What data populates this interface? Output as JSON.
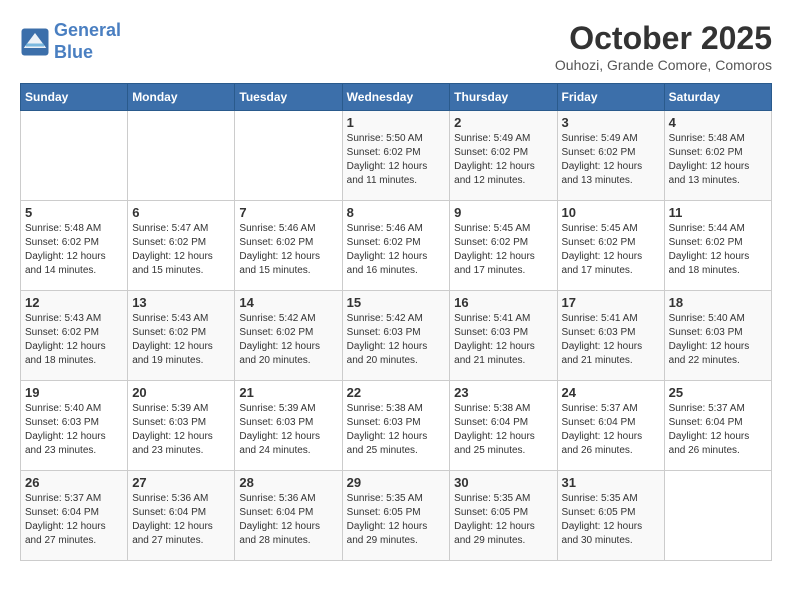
{
  "header": {
    "logo_line1": "General",
    "logo_line2": "Blue",
    "month": "October 2025",
    "location": "Ouhozi, Grande Comore, Comoros"
  },
  "weekdays": [
    "Sunday",
    "Monday",
    "Tuesday",
    "Wednesday",
    "Thursday",
    "Friday",
    "Saturday"
  ],
  "weeks": [
    [
      {
        "day": "",
        "sunrise": "",
        "sunset": "",
        "daylight": ""
      },
      {
        "day": "",
        "sunrise": "",
        "sunset": "",
        "daylight": ""
      },
      {
        "day": "",
        "sunrise": "",
        "sunset": "",
        "daylight": ""
      },
      {
        "day": "1",
        "sunrise": "Sunrise: 5:50 AM",
        "sunset": "Sunset: 6:02 PM",
        "daylight": "Daylight: 12 hours and 11 minutes."
      },
      {
        "day": "2",
        "sunrise": "Sunrise: 5:49 AM",
        "sunset": "Sunset: 6:02 PM",
        "daylight": "Daylight: 12 hours and 12 minutes."
      },
      {
        "day": "3",
        "sunrise": "Sunrise: 5:49 AM",
        "sunset": "Sunset: 6:02 PM",
        "daylight": "Daylight: 12 hours and 13 minutes."
      },
      {
        "day": "4",
        "sunrise": "Sunrise: 5:48 AM",
        "sunset": "Sunset: 6:02 PM",
        "daylight": "Daylight: 12 hours and 13 minutes."
      }
    ],
    [
      {
        "day": "5",
        "sunrise": "Sunrise: 5:48 AM",
        "sunset": "Sunset: 6:02 PM",
        "daylight": "Daylight: 12 hours and 14 minutes."
      },
      {
        "day": "6",
        "sunrise": "Sunrise: 5:47 AM",
        "sunset": "Sunset: 6:02 PM",
        "daylight": "Daylight: 12 hours and 15 minutes."
      },
      {
        "day": "7",
        "sunrise": "Sunrise: 5:46 AM",
        "sunset": "Sunset: 6:02 PM",
        "daylight": "Daylight: 12 hours and 15 minutes."
      },
      {
        "day": "8",
        "sunrise": "Sunrise: 5:46 AM",
        "sunset": "Sunset: 6:02 PM",
        "daylight": "Daylight: 12 hours and 16 minutes."
      },
      {
        "day": "9",
        "sunrise": "Sunrise: 5:45 AM",
        "sunset": "Sunset: 6:02 PM",
        "daylight": "Daylight: 12 hours and 17 minutes."
      },
      {
        "day": "10",
        "sunrise": "Sunrise: 5:45 AM",
        "sunset": "Sunset: 6:02 PM",
        "daylight": "Daylight: 12 hours and 17 minutes."
      },
      {
        "day": "11",
        "sunrise": "Sunrise: 5:44 AM",
        "sunset": "Sunset: 6:02 PM",
        "daylight": "Daylight: 12 hours and 18 minutes."
      }
    ],
    [
      {
        "day": "12",
        "sunrise": "Sunrise: 5:43 AM",
        "sunset": "Sunset: 6:02 PM",
        "daylight": "Daylight: 12 hours and 18 minutes."
      },
      {
        "day": "13",
        "sunrise": "Sunrise: 5:43 AM",
        "sunset": "Sunset: 6:02 PM",
        "daylight": "Daylight: 12 hours and 19 minutes."
      },
      {
        "day": "14",
        "sunrise": "Sunrise: 5:42 AM",
        "sunset": "Sunset: 6:02 PM",
        "daylight": "Daylight: 12 hours and 20 minutes."
      },
      {
        "day": "15",
        "sunrise": "Sunrise: 5:42 AM",
        "sunset": "Sunset: 6:03 PM",
        "daylight": "Daylight: 12 hours and 20 minutes."
      },
      {
        "day": "16",
        "sunrise": "Sunrise: 5:41 AM",
        "sunset": "Sunset: 6:03 PM",
        "daylight": "Daylight: 12 hours and 21 minutes."
      },
      {
        "day": "17",
        "sunrise": "Sunrise: 5:41 AM",
        "sunset": "Sunset: 6:03 PM",
        "daylight": "Daylight: 12 hours and 21 minutes."
      },
      {
        "day": "18",
        "sunrise": "Sunrise: 5:40 AM",
        "sunset": "Sunset: 6:03 PM",
        "daylight": "Daylight: 12 hours and 22 minutes."
      }
    ],
    [
      {
        "day": "19",
        "sunrise": "Sunrise: 5:40 AM",
        "sunset": "Sunset: 6:03 PM",
        "daylight": "Daylight: 12 hours and 23 minutes."
      },
      {
        "day": "20",
        "sunrise": "Sunrise: 5:39 AM",
        "sunset": "Sunset: 6:03 PM",
        "daylight": "Daylight: 12 hours and 23 minutes."
      },
      {
        "day": "21",
        "sunrise": "Sunrise: 5:39 AM",
        "sunset": "Sunset: 6:03 PM",
        "daylight": "Daylight: 12 hours and 24 minutes."
      },
      {
        "day": "22",
        "sunrise": "Sunrise: 5:38 AM",
        "sunset": "Sunset: 6:03 PM",
        "daylight": "Daylight: 12 hours and 25 minutes."
      },
      {
        "day": "23",
        "sunrise": "Sunrise: 5:38 AM",
        "sunset": "Sunset: 6:04 PM",
        "daylight": "Daylight: 12 hours and 25 minutes."
      },
      {
        "day": "24",
        "sunrise": "Sunrise: 5:37 AM",
        "sunset": "Sunset: 6:04 PM",
        "daylight": "Daylight: 12 hours and 26 minutes."
      },
      {
        "day": "25",
        "sunrise": "Sunrise: 5:37 AM",
        "sunset": "Sunset: 6:04 PM",
        "daylight": "Daylight: 12 hours and 26 minutes."
      }
    ],
    [
      {
        "day": "26",
        "sunrise": "Sunrise: 5:37 AM",
        "sunset": "Sunset: 6:04 PM",
        "daylight": "Daylight: 12 hours and 27 minutes."
      },
      {
        "day": "27",
        "sunrise": "Sunrise: 5:36 AM",
        "sunset": "Sunset: 6:04 PM",
        "daylight": "Daylight: 12 hours and 27 minutes."
      },
      {
        "day": "28",
        "sunrise": "Sunrise: 5:36 AM",
        "sunset": "Sunset: 6:04 PM",
        "daylight": "Daylight: 12 hours and 28 minutes."
      },
      {
        "day": "29",
        "sunrise": "Sunrise: 5:35 AM",
        "sunset": "Sunset: 6:05 PM",
        "daylight": "Daylight: 12 hours and 29 minutes."
      },
      {
        "day": "30",
        "sunrise": "Sunrise: 5:35 AM",
        "sunset": "Sunset: 6:05 PM",
        "daylight": "Daylight: 12 hours and 29 minutes."
      },
      {
        "day": "31",
        "sunrise": "Sunrise: 5:35 AM",
        "sunset": "Sunset: 6:05 PM",
        "daylight": "Daylight: 12 hours and 30 minutes."
      },
      {
        "day": "",
        "sunrise": "",
        "sunset": "",
        "daylight": ""
      }
    ]
  ]
}
